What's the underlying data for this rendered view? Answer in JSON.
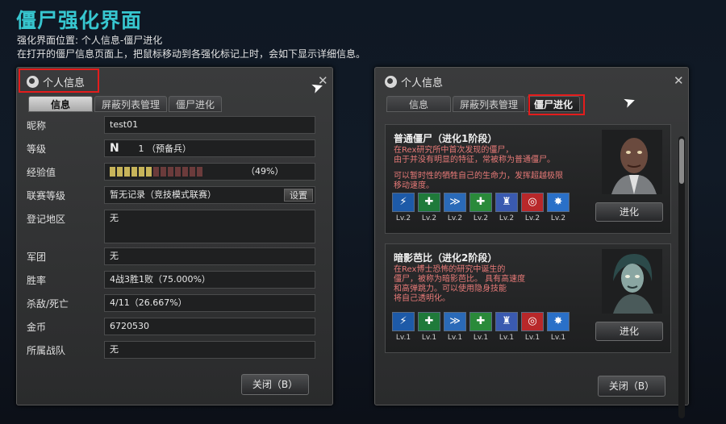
{
  "header": {
    "title": "僵尸强化界面",
    "line1": "强化界面位置: 个人信息-僵尸进化",
    "line2": "在打开的僵尸信息页面上，把鼠标移动到各强化标记上时，会如下显示详细信息。"
  },
  "left": {
    "title": "个人信息",
    "close": "✕",
    "tabs": [
      "信息",
      "屏蔽列表管理",
      "僵尸进化"
    ],
    "rows": {
      "nickname": {
        "label": "昵称",
        "value": "test01"
      },
      "level": {
        "label": "等级",
        "rank_icon": "N",
        "value": "1 （预备兵）"
      },
      "exp": {
        "label": "经验值",
        "value": "（49%）",
        "filled": 6,
        "total": 13
      },
      "league": {
        "label": "联赛等级",
        "value": "暂无记录（竞技模式联赛）",
        "button": "设置"
      },
      "region": {
        "label": "登记地区",
        "value": "无"
      },
      "corps": {
        "label": "军团",
        "value": "无"
      },
      "winrate": {
        "label": "胜率",
        "value": "4战3胜1败（75.000%）"
      },
      "kd": {
        "label": "杀敌/死亡",
        "value": "4/11（26.667%）"
      },
      "gold": {
        "label": "金币",
        "value": "6720530"
      },
      "team": {
        "label": "所属战队",
        "value": "无"
      }
    },
    "close_button": "关闭（B）"
  },
  "right": {
    "title": "个人信息",
    "close": "✕",
    "tabs": [
      "信息",
      "屏蔽列表管理",
      "僵尸进化"
    ],
    "cards": [
      {
        "title": "普通僵尸（进化1阶段）",
        "desc": [
          "在Rex研究所中首次发现的僵尸，",
          "由于并没有明显的特征，常被称为普通僵尸。",
          "",
          "可以暂时性的牺牲自己的生命力，发挥超越极限",
          "移动速度。"
        ],
        "levels": [
          "Lv.2",
          "Lv.2",
          "Lv.2",
          "Lv.2",
          "Lv.2",
          "Lv.2",
          "Lv.2"
        ],
        "button": "进化"
      },
      {
        "title": "暗影芭比（进化2阶段）",
        "desc": [
          "在Rex博士恐怖的研究中诞生的",
          "僵尸，被称为暗影芭比。 具有高速度",
          "和高弹跳力。可以使用隐身技能",
          "将自己透明化。"
        ],
        "levels": [
          "Lv.1",
          "Lv.1",
          "Lv.1",
          "Lv.1",
          "Lv.1",
          "Lv.1",
          "Lv.1"
        ],
        "button": "进化"
      }
    ],
    "skill_icons": [
      "foot-icon",
      "heal-icon",
      "run-icon",
      "plus-icon",
      "armor-icon",
      "target-icon",
      "burst-icon"
    ],
    "close_button": "关闭（B）"
  },
  "colors": {
    "accent": "#37c6cf",
    "highlight": "#e41c1c",
    "desc": "#e87a78",
    "exp_fill": "#c7b45a",
    "exp_empty": "#6b3b3b"
  }
}
